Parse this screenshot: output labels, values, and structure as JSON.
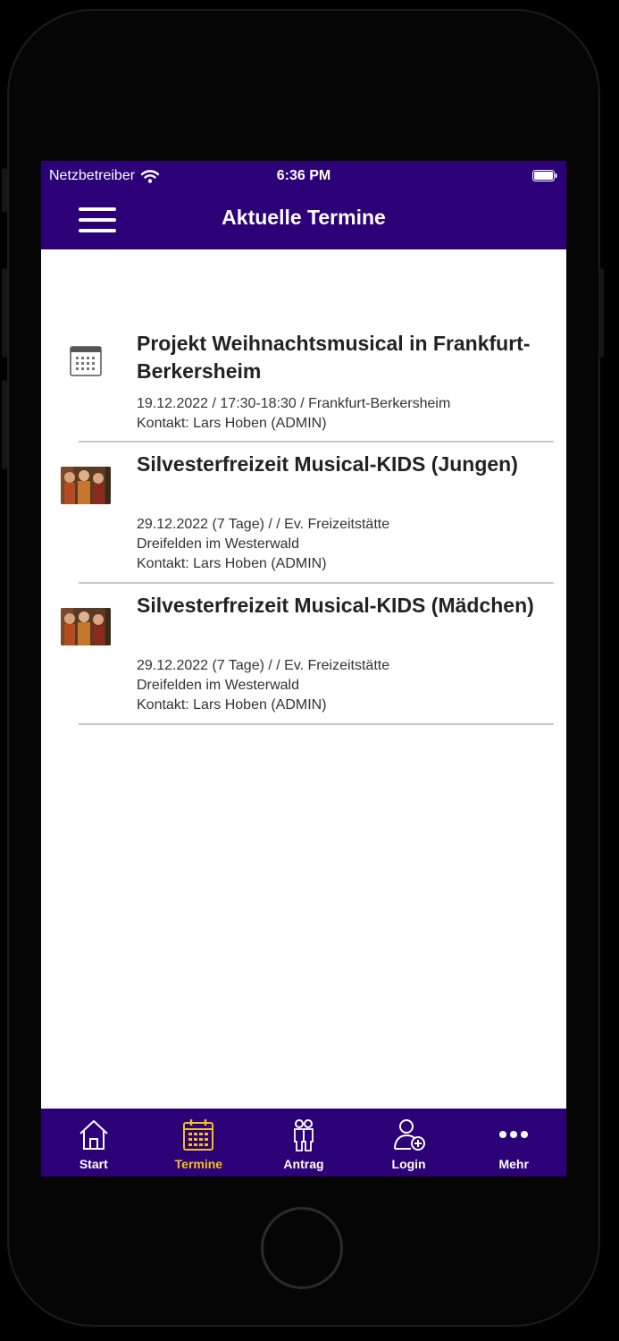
{
  "status_bar": {
    "carrier": "Netzbetreiber",
    "time": "6:36 PM",
    "wifi_icon": "wifi-icon",
    "battery_icon": "battery-icon"
  },
  "nav": {
    "title": "Aktuelle Termine",
    "menu_icon": "hamburger-menu-icon"
  },
  "events": [
    {
      "icon": "calendar-icon",
      "title": "Projekt Weihnachtsmusical in Frankfurt-Berkersheim",
      "details": [
        "19.12.2022 / 17:30-18:30 / Frankfurt-Berkersheim",
        "Kontakt: Lars Hoben (ADMIN)"
      ]
    },
    {
      "icon": "event-photo-thumbnail",
      "title": "Silvesterfreizeit Musical-KIDS (Jungen)",
      "details": [
        "29.12.2022 (7 Tage) /   / Ev. Freizeitstätte",
        "Dreifelden im Westerwald",
        "Kontakt: Lars Hoben (ADMIN)"
      ]
    },
    {
      "icon": "event-photo-thumbnail",
      "title": "Silvesterfreizeit Musical-KIDS (Mädchen)",
      "details": [
        "29.12.2022 (7 Tage) /   / Ev. Freizeitstätte",
        "Dreifelden im Westerwald",
        "Kontakt: Lars Hoben (ADMIN)"
      ]
    }
  ],
  "tabs": [
    {
      "label": "Start",
      "icon": "home-icon",
      "active": false
    },
    {
      "label": "Termine",
      "icon": "calendar-icon",
      "active": true
    },
    {
      "label": "Antrag",
      "icon": "people-icon",
      "active": false
    },
    {
      "label": "Login",
      "icon": "add-user-icon",
      "active": false
    },
    {
      "label": "Mehr",
      "icon": "more-dots-icon",
      "active": false
    }
  ],
  "colors": {
    "brand": "#2c0178",
    "active_tab": "#f2c21a",
    "background": "#ffffff"
  }
}
